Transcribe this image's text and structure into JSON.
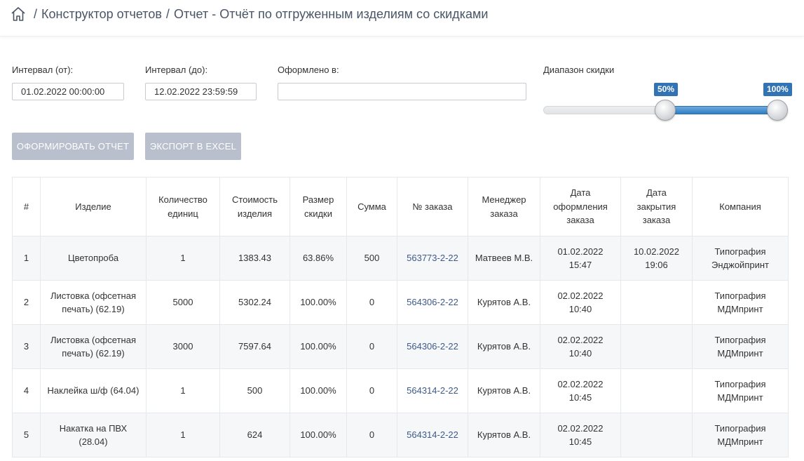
{
  "breadcrumb": {
    "items": [
      "Конструктор отчетов",
      "Отчет - Отчёт по отгруженным изделиям со скидками"
    ],
    "separator": "/"
  },
  "filters": {
    "from_label": "Интервал (от):",
    "from_value": "01.02.2022 00:00:00",
    "to_label": "Интервал (до):",
    "to_value": "12.02.2022 23:59:59",
    "issued_label": "Оформлено в:",
    "issued_value": "",
    "discount_label": "Диапазон скидки",
    "discount_min": "50%",
    "discount_max": "100%",
    "discount_min_value": 50,
    "discount_max_value": 100
  },
  "actions": {
    "generate_label": "Оформировать отчет",
    "export_label": "Экспорт в Excel"
  },
  "table": {
    "headers": [
      "#",
      "Изделие",
      "Количество единиц",
      "Стоимость изделия",
      "Размер скидки",
      "Сумма",
      "№ заказа",
      "Менеджер заказа",
      "Дата оформления заказа",
      "Дата закрытия заказа",
      "Компания"
    ],
    "rows": [
      [
        "1",
        "Цветопроба",
        "1",
        "1383.43",
        "63.86%",
        "500",
        "563773-2-22",
        "Матвеев М.В.",
        "01.02.2022 15:47",
        "10.02.2022 19:06",
        "Типография Энджойпринт"
      ],
      [
        "2",
        "Листовка (офсетная печать) (62.19)",
        "5000",
        "5302.24",
        "100.00%",
        "0",
        "564306-2-22",
        "Курятов А.В.",
        "02.02.2022 10:40",
        "",
        "Типография МДМпринт"
      ],
      [
        "3",
        "Листовка (офсетная печать) (62.19)",
        "3000",
        "7597.64",
        "100.00%",
        "0",
        "564306-2-22",
        "Курятов А.В.",
        "02.02.2022 10:40",
        "",
        "Типография МДМпринт"
      ],
      [
        "4",
        "Наклейка ш/ф (64.04)",
        "1",
        "500",
        "100.00%",
        "0",
        "564314-2-22",
        "Курятов А.В.",
        "02.02.2022 10:45",
        "",
        "Типография МДМпринт"
      ],
      [
        "5",
        "Накатка на ПВХ (28.04)",
        "1",
        "624",
        "100.00%",
        "0",
        "564314-2-22",
        "Курятов А.В.",
        "02.02.2022 10:45",
        "",
        "Типография МДМпринт"
      ]
    ]
  },
  "colors": {
    "accent": "#3173b3",
    "link": "#3d5a8a",
    "button": "#b9bfcd"
  },
  "icons": {
    "home": "home-icon"
  }
}
